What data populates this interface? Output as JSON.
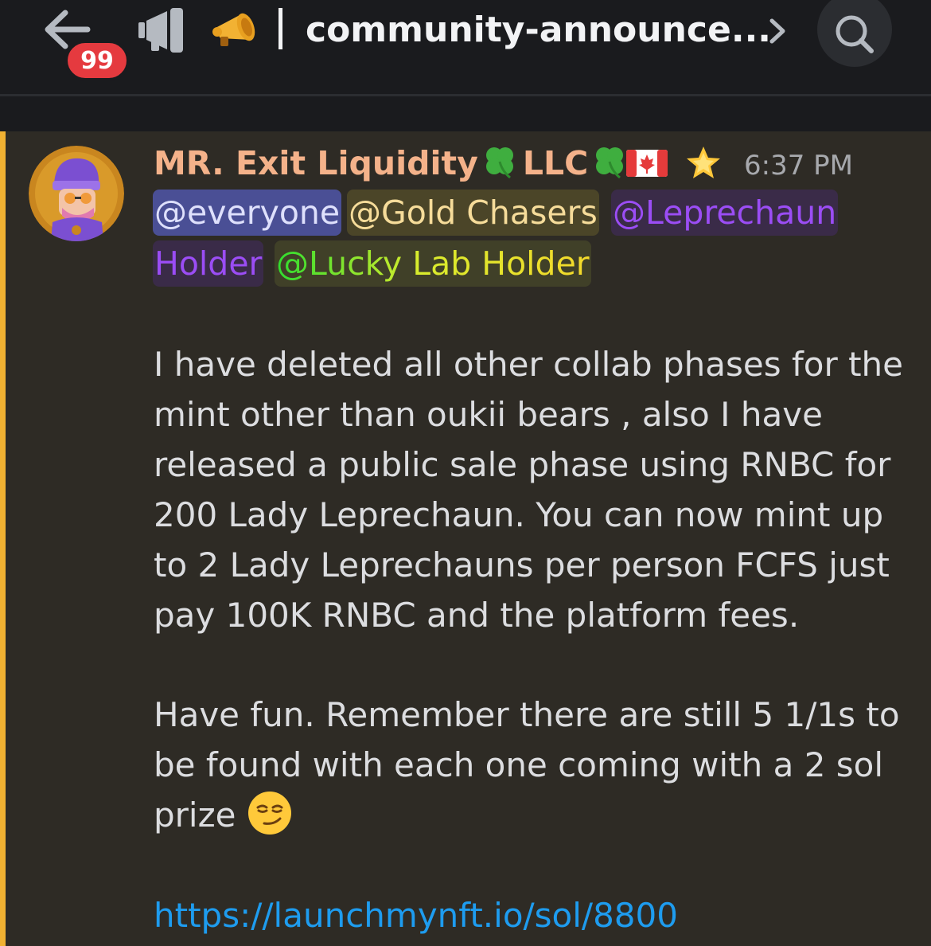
{
  "header": {
    "back_icon": "arrow-left-icon",
    "unread_badge": "99",
    "channel_type_icon": "announcement-megaphone-icon",
    "channel_emoji": "megaphone-emoji",
    "channel_name": "community-announce...",
    "chevron_icon": "chevron-right-icon",
    "search_icon": "search-icon"
  },
  "message": {
    "author": {
      "name_part1": "MR. Exit Liquidity",
      "name_part2": "LLC",
      "color": "#f4b28a",
      "badges": [
        "four-leaf-clover-emoji",
        "canada-flag-icon",
        "glowing-star-icon"
      ]
    },
    "timestamp": "6:37 PM",
    "mentions": {
      "everyone": "@everyone",
      "gold_chasers": "@Gold Chasers",
      "leprechaun_line1": "@Leprechaun",
      "leprechaun_line2": "Holder",
      "lucky_lab": "@Lucky Lab Holder"
    },
    "paragraph1": "I have deleted all other collab phases for the mint other than oukii bears , also I have released a public sale phase using RNBC for 200 Lady Leprechaun. You can now mint up to 2 Lady Leprechauns per person FCFS just pay 100K RNBC and the platform fees.",
    "paragraph2": "Have fun. Remember there are still 5 1/1s to be found with each one coming with a 2 sol prize",
    "paragraph2_emoji": "smirking-face-emoji",
    "link": "https://launchmynft.io/sol/8800",
    "colors": {
      "mention_highlight_bar": "#f0b132",
      "link": "#1e9cef",
      "everyone_bg": "#4a4f95",
      "leprechaun_role": "#9b4df5"
    }
  }
}
